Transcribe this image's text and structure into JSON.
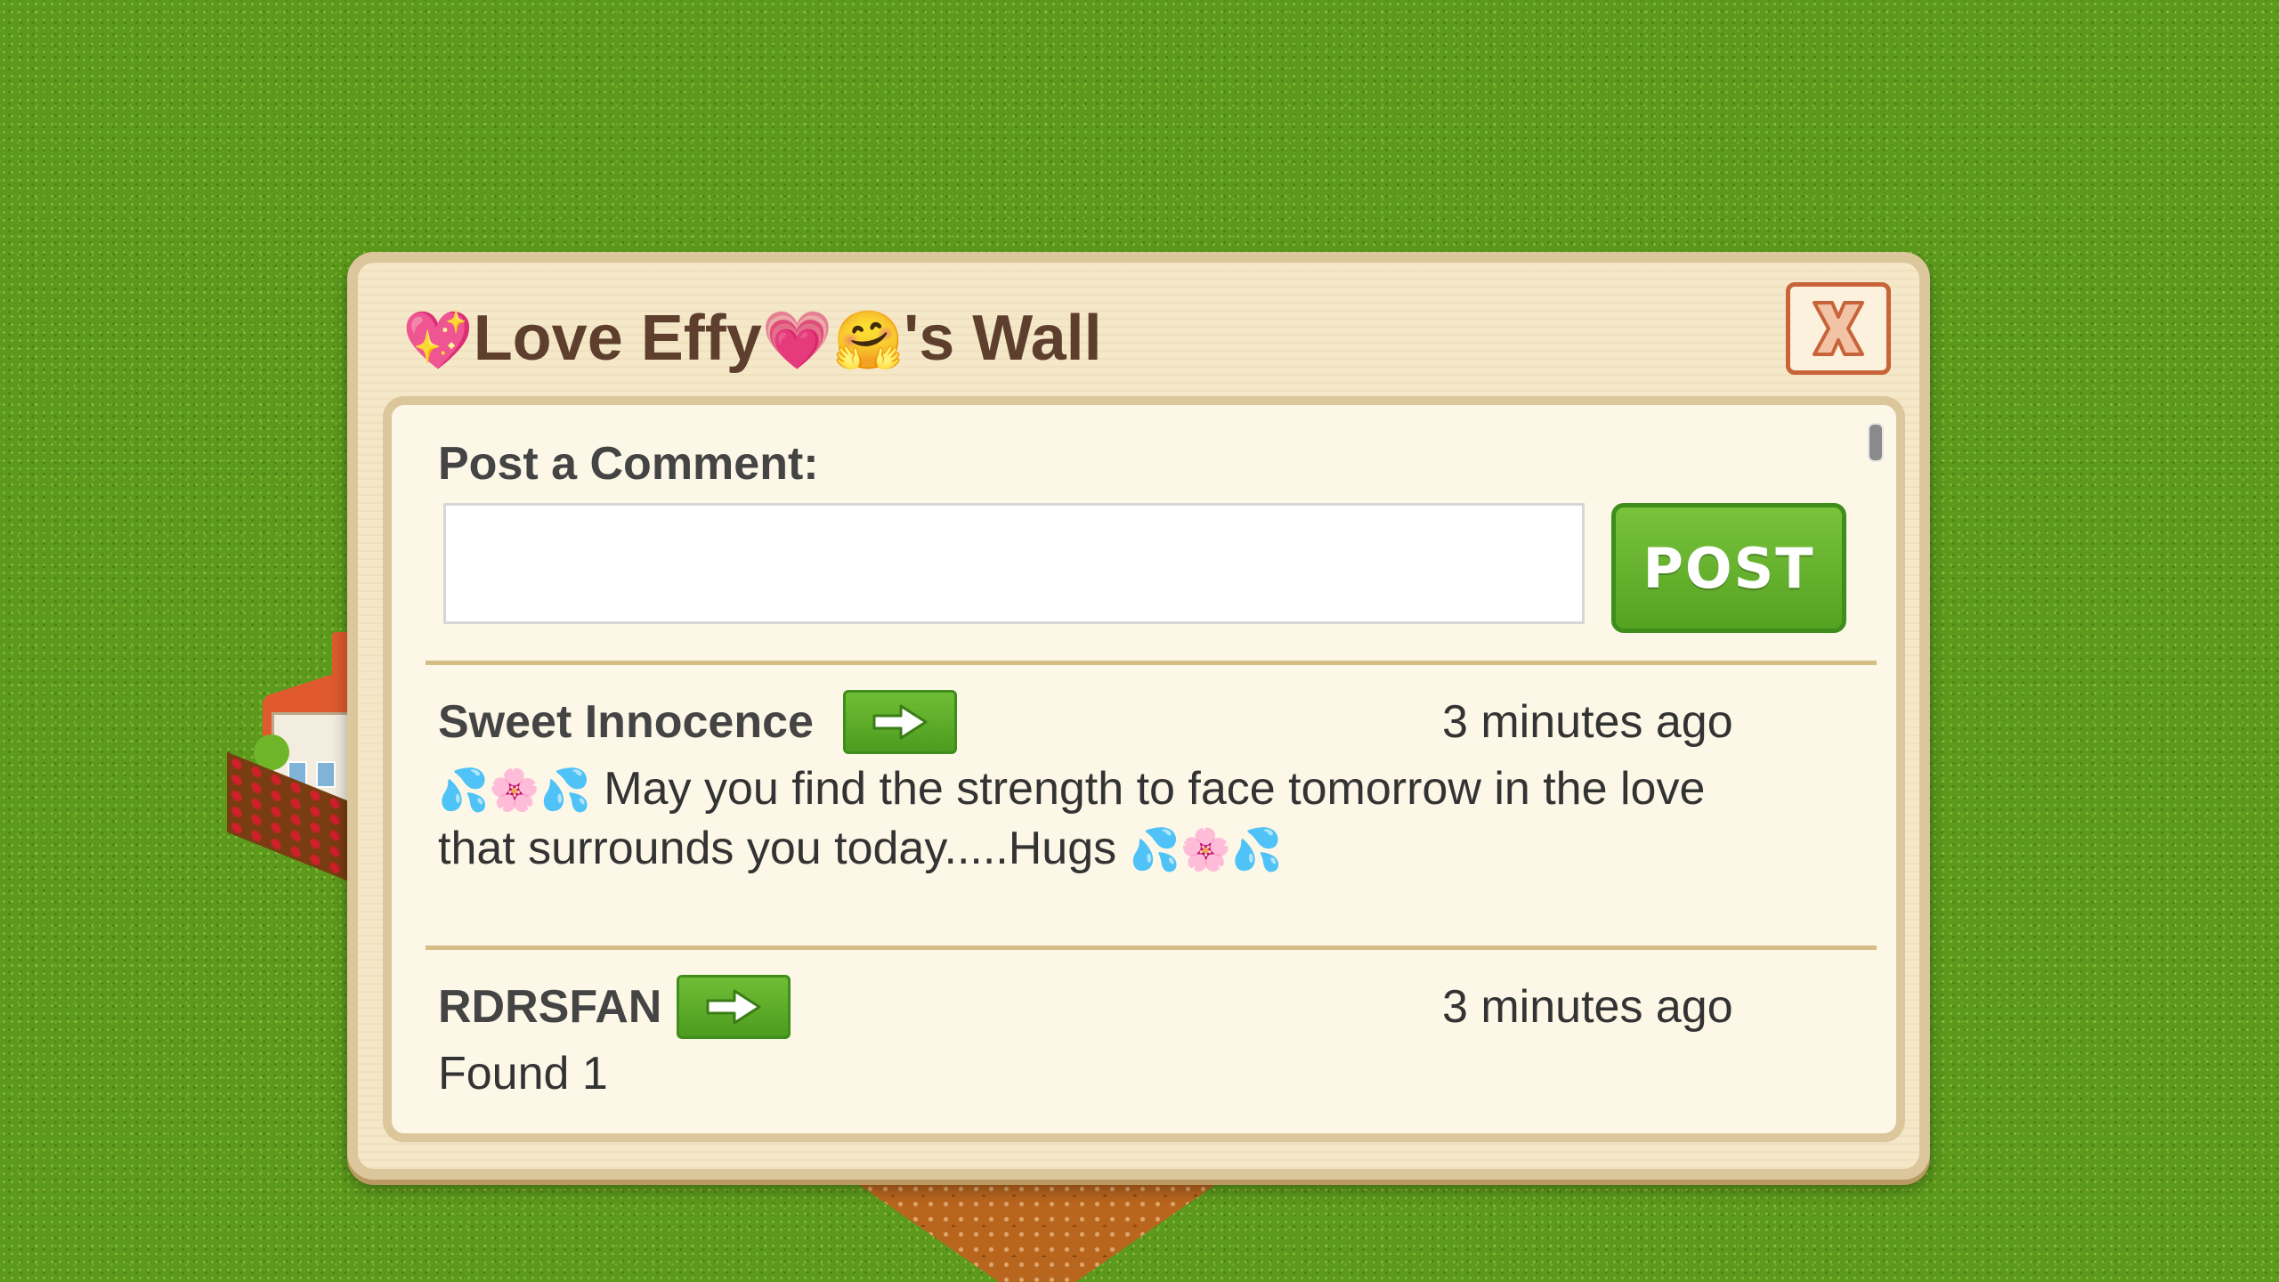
{
  "dialog": {
    "title_prefix_emoji": "💖",
    "title_name": "Love Effy",
    "title_mid_emoji": "💗",
    "title_end_emoji": "🤗",
    "title_suffix": "'s Wall",
    "close_label": "X",
    "colors": {
      "title": "#5e3f2e",
      "close_border": "#c8643a",
      "post_button": "#5aa727",
      "frame": "#dcc79c"
    }
  },
  "composer": {
    "label": "Post a Comment:",
    "input_value": "",
    "input_placeholder": "",
    "post_label": "POST"
  },
  "posts": [
    {
      "author": "Sweet Innocence",
      "time": "3 minutes ago",
      "body_emoji_start": "💦🌸💦",
      "body_line1": "May you find the strength to face tomorrow in the love",
      "body_line2": "that surrounds you today.....Hugs",
      "body_emoji_end": "💦🌸💦",
      "visit_icon": "arrow-right-icon"
    },
    {
      "author": "RDRSFAN",
      "time": "3 minutes ago",
      "body": "Found 1",
      "visit_icon": "arrow-right-icon"
    }
  ]
}
